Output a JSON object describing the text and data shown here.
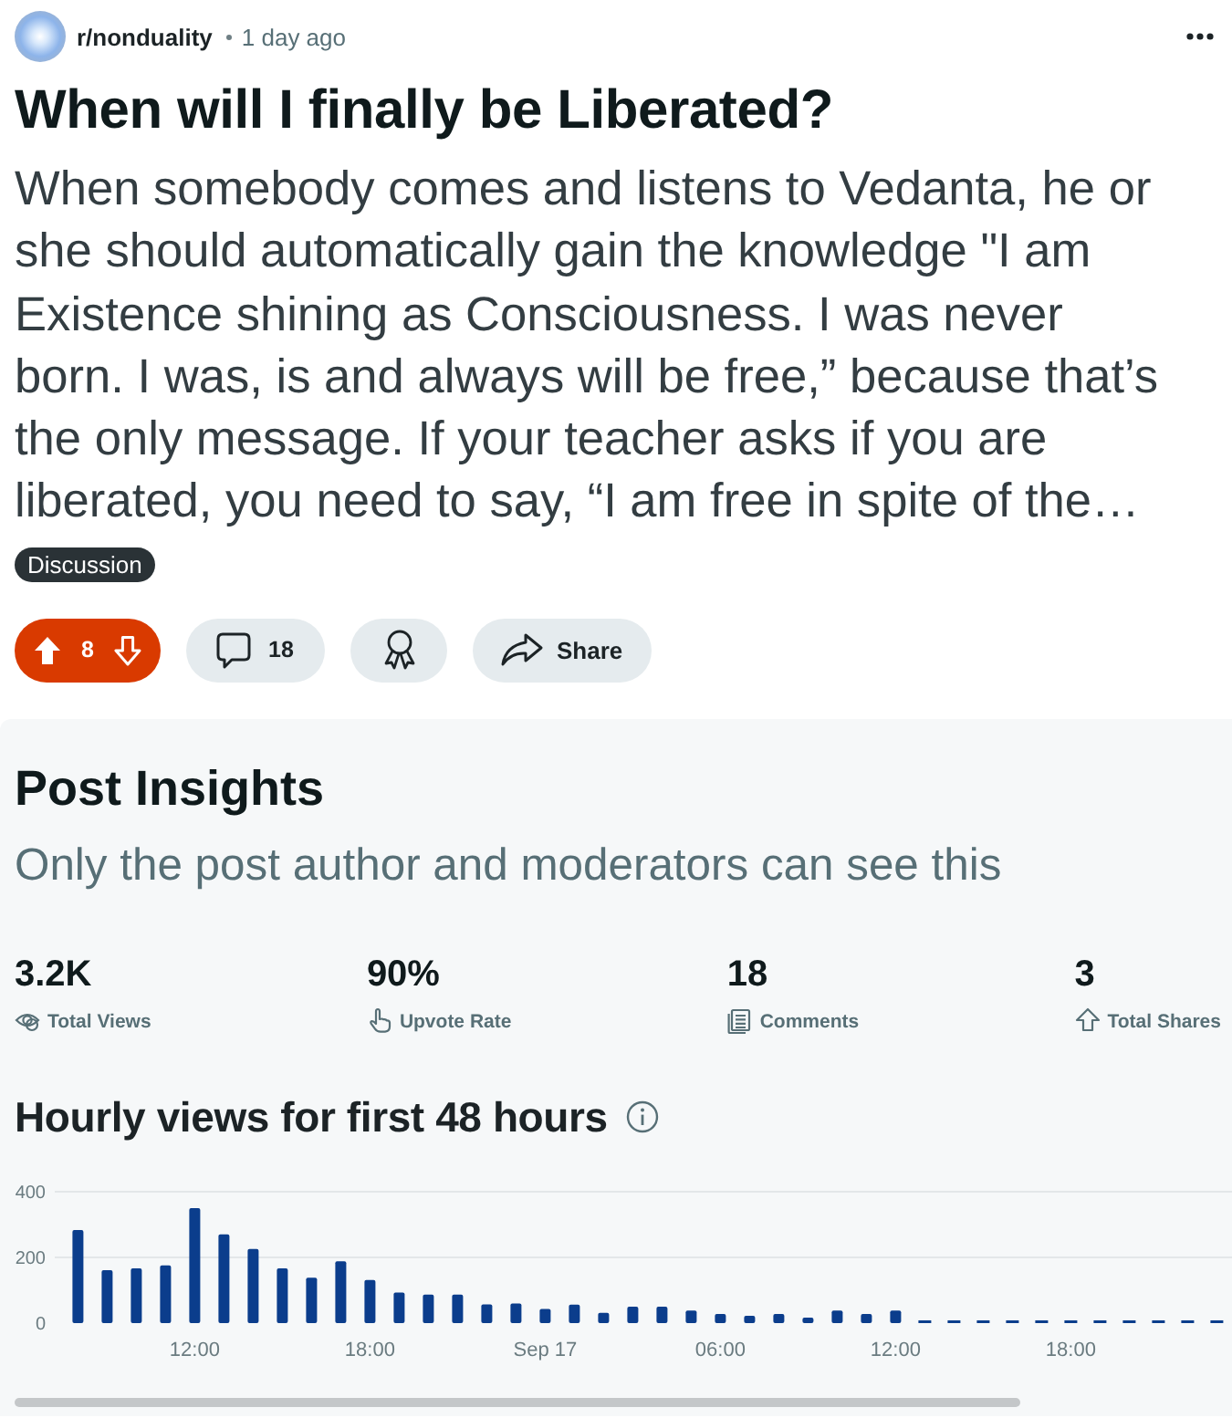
{
  "post": {
    "subreddit": "r/nonduality",
    "time": "1 day ago",
    "title": "When will I finally be Liberated?",
    "body": "When somebody comes and listens to Vedanta, he or she should automatically gain the knowledge \"I am Existence shining as Consciousness. I was never born. I was, is and always will be free,” because that’s the only message. If your teacher asks if you are liberated, you need to say, “I am free in spite of the…",
    "flair": "Discussion"
  },
  "actions": {
    "vote": {
      "score": "8",
      "upvoted": true
    },
    "comments": "18",
    "share": "Share"
  },
  "insights": {
    "title": "Post Insights",
    "subtitle": "Only the post author and moderators can see this",
    "stats": [
      {
        "kind": "views",
        "value": "3.2K",
        "label": "Total Views"
      },
      {
        "kind": "upvote_rate",
        "value": "90%",
        "label": "Upvote Rate"
      },
      {
        "kind": "comments",
        "value": "18",
        "label": "Comments"
      },
      {
        "kind": "shares",
        "value": "3",
        "label": "Total Shares"
      }
    ],
    "chart": {
      "title": "Hourly views for first 48 hours",
      "chart_data": {
        "type": "bar",
        "categories": [
          null,
          null,
          null,
          null,
          "12:00",
          null,
          null,
          null,
          null,
          null,
          "18:00",
          null,
          null,
          null,
          null,
          null,
          "Sep 17",
          null,
          null,
          null,
          null,
          null,
          "06:00",
          null,
          null,
          null,
          null,
          null,
          "12:00",
          null,
          null,
          null,
          null,
          null,
          "18:00",
          null,
          null,
          null,
          null,
          null
        ],
        "values": [
          283,
          161,
          167,
          176,
          350,
          270,
          226,
          167,
          138,
          188,
          131,
          93,
          87,
          87,
          57,
          60,
          43,
          56,
          31,
          50,
          50,
          38,
          28,
          22,
          28,
          17,
          38,
          28,
          38,
          0,
          0,
          0,
          0,
          0,
          0,
          0,
          0,
          0,
          0,
          0
        ],
        "ylim": [
          0,
          400
        ],
        "yticks": [
          0,
          200,
          400
        ]
      }
    }
  }
}
